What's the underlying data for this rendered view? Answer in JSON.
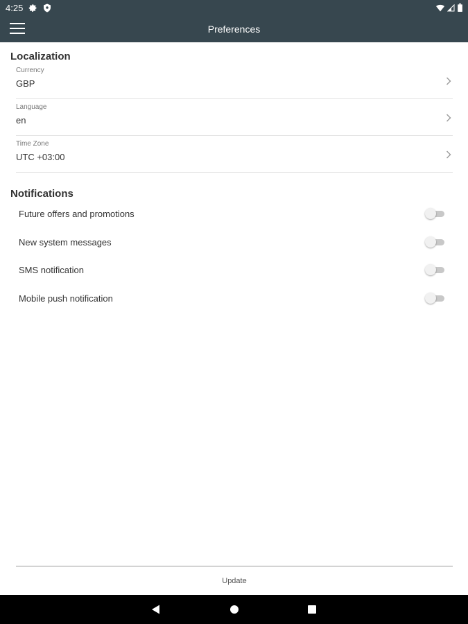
{
  "status_bar": {
    "time": "4:25",
    "icons": [
      "gear-icon",
      "shield-icon",
      "wifi-icon",
      "signal-icon",
      "battery-icon"
    ]
  },
  "app_bar": {
    "title": "Preferences",
    "menu_icon": "hamburger-menu-icon"
  },
  "localization": {
    "title": "Localization",
    "items": [
      {
        "label": "Currency",
        "value": "GBP"
      },
      {
        "label": "Language",
        "value": "en"
      },
      {
        "label": "Time Zone",
        "value": "UTC +03:00"
      }
    ]
  },
  "notifications": {
    "title": "Notifications",
    "items": [
      {
        "label": "Future offers and promotions",
        "enabled": false
      },
      {
        "label": "New system messages",
        "enabled": false
      },
      {
        "label": "SMS notification",
        "enabled": false
      },
      {
        "label": "Mobile push notification",
        "enabled": false
      }
    ]
  },
  "footer": {
    "update_label": "Update"
  },
  "nav_bar": {
    "icons": [
      "back-icon",
      "home-icon",
      "recents-icon"
    ]
  },
  "colors": {
    "app_bar": "#37474f",
    "toggle_off_track": "#c8c8c8",
    "toggle_off_knob": "#f1f1f1"
  }
}
